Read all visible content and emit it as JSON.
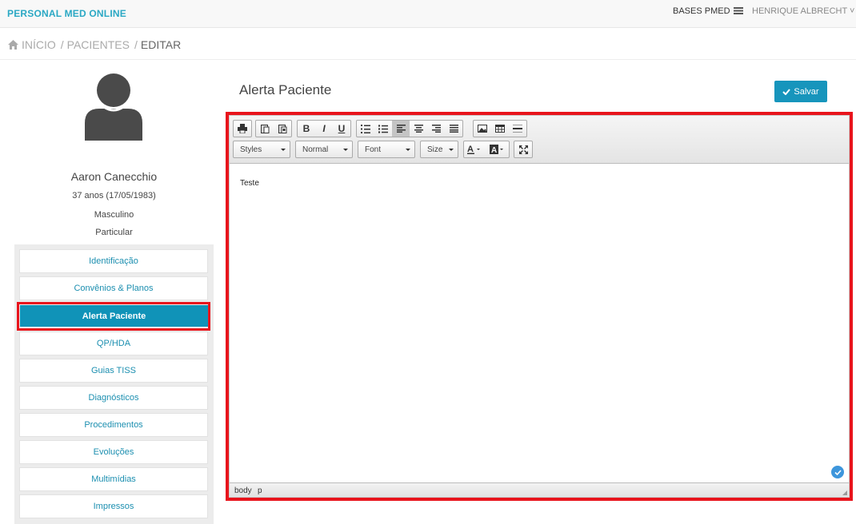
{
  "topbar": {
    "brand": "PERSONAL MED ONLINE",
    "bases": "BASES PMED",
    "user": "HENRIQUE ALBRECHT ˅"
  },
  "breadcrumb": {
    "home": "INÍCIO",
    "patients": "PACIENTES",
    "current": "EDITAR",
    "separator": "/"
  },
  "patient": {
    "name": "Aaron Canecchio",
    "age": "37 anos (17/05/1983)",
    "sex": "Masculino",
    "plan": "Particular"
  },
  "menu": {
    "items": [
      {
        "label": "Identificação"
      },
      {
        "label": "Convênios & Planos"
      },
      {
        "label": "Alerta Paciente"
      },
      {
        "label": "QP/HDA"
      },
      {
        "label": "Guias TISS"
      },
      {
        "label": "Diagnósticos"
      },
      {
        "label": "Procedimentos"
      },
      {
        "label": "Evoluções"
      },
      {
        "label": "Multimídias"
      },
      {
        "label": "Impressos"
      }
    ],
    "active": "Alerta Paciente"
  },
  "main": {
    "title": "Alerta Paciente",
    "save_label": "Salvar"
  },
  "editor": {
    "styles": "Styles",
    "format": "Normal",
    "font": "Font",
    "size": "Size",
    "content": "Teste",
    "path": [
      "body",
      "p"
    ]
  },
  "colors": {
    "accent": "#1795bc",
    "brand": "#2aa8c4",
    "highlight": "#e8141c"
  }
}
